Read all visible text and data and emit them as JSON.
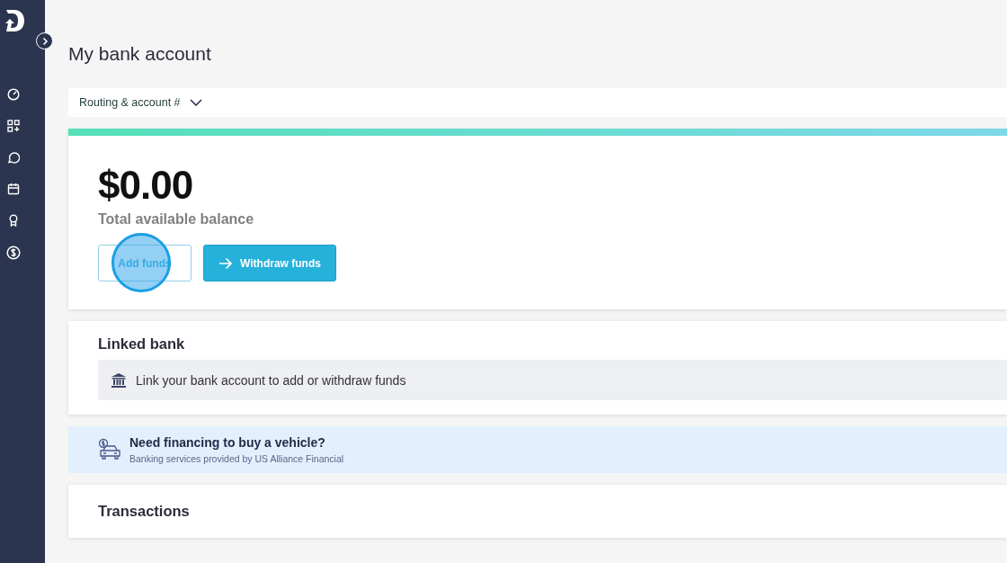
{
  "page": {
    "title": "My bank account"
  },
  "account_toggle": {
    "label": "Routing & account #",
    "expanded": false
  },
  "balance": {
    "amount": "$0.00",
    "label": "Total available balance"
  },
  "actions": [
    {
      "label": "Add funds",
      "kind": "outline"
    },
    {
      "label": "Withdraw funds",
      "kind": "primary"
    }
  ],
  "linked_bank": {
    "heading": "Linked bank",
    "prompt": "Link your bank account to add or withdraw funds"
  },
  "financing": {
    "title": "Need financing to buy a vehicle?",
    "subtitle": "Banking services provided by US Alliance Financial"
  },
  "transactions": {
    "heading": "Transactions"
  }
}
